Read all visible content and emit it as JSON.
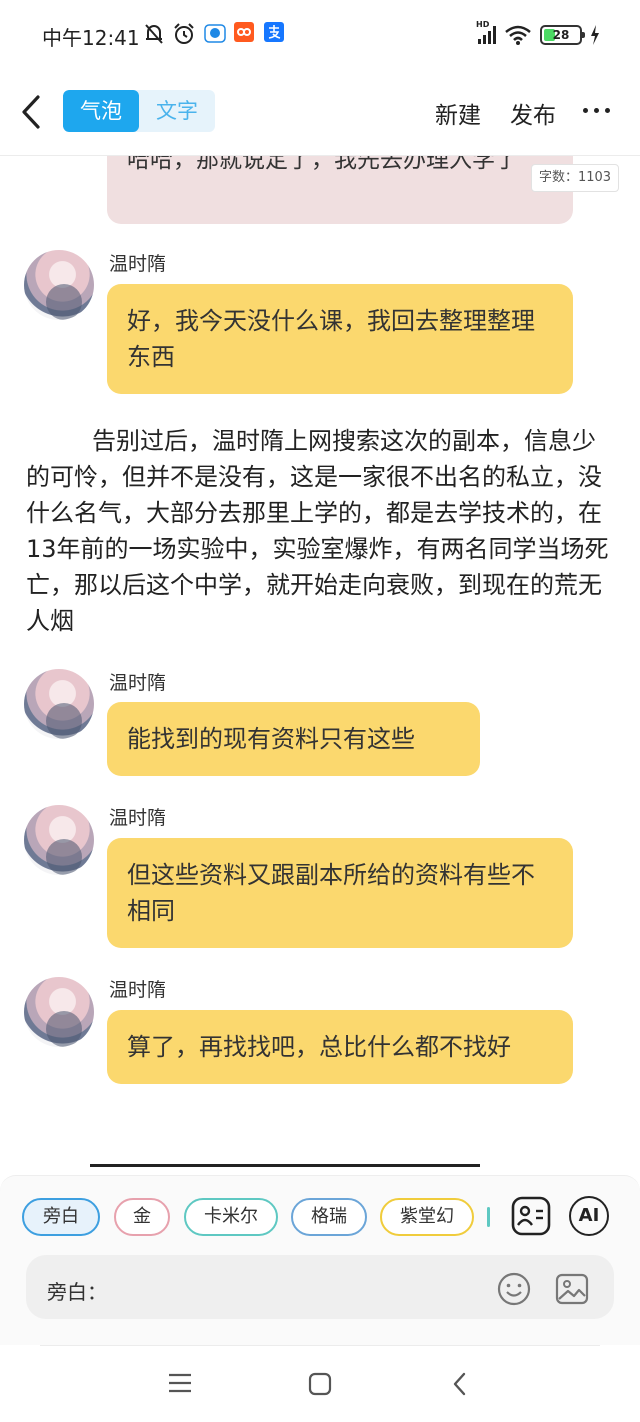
{
  "status": {
    "time": "中午12:41",
    "hd": "HD",
    "battery": "28"
  },
  "header": {
    "tab_bubble": "气泡",
    "tab_text": "文字",
    "new_label": "新建",
    "publish_label": "发布"
  },
  "word_count": "字数：1103",
  "messages": [
    {
      "text": "哈哈，那就说定了，我先去办理入学了"
    },
    {
      "name": "温时隋",
      "text": "好，我今天没什么课，我回去整理整理东西"
    },
    {
      "narration": "告别过后，温时隋上网搜索这次的副本，信息少的可怜，但并不是没有，这是一家很不出名的私立，没什么名气，大部分去那里上学的，都是去学技术的，在13年前的一场实验中，实验室爆炸，有两名同学当场死亡，那以后这个中学，就开始走向衰败，到现在的荒无人烟"
    },
    {
      "name": "温时隋",
      "text": "能找到的现有资料只有这些"
    },
    {
      "name": "温时隋",
      "text": "但这些资料又跟副本所给的资料有些不相同"
    },
    {
      "name": "温时隋",
      "text": "算了，再找找吧，总比什么都不找好"
    }
  ],
  "characters": [
    "旁白",
    "金",
    "卡米尔",
    "格瑞",
    "紫堂幻"
  ],
  "character_colors": [
    "#3d9fe0",
    "#e7a1ad",
    "#5ec8c2",
    "#6ba5d8",
    "#f0cc3c"
  ],
  "ai_label": "AI",
  "input_label": "旁白："
}
